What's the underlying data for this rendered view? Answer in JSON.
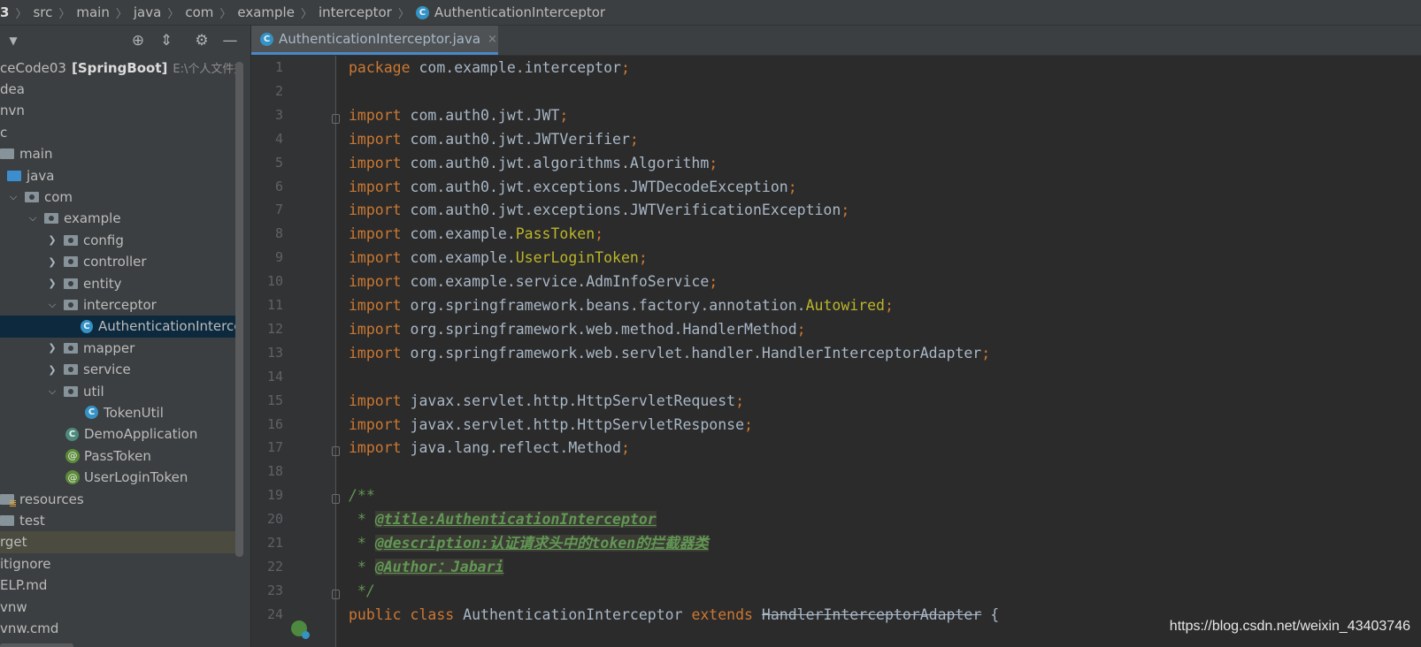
{
  "breadcrumb": [
    "3",
    "src",
    "main",
    "java",
    "com",
    "example",
    "interceptor",
    "AuthenticationInterceptor"
  ],
  "sidebar": {
    "toolbar_icons": [
      "chevron-down-icon",
      "locate-icon",
      "collapse-icon",
      "gear-icon",
      "minimize-icon"
    ],
    "project_name": "ceCode03",
    "project_module": "[SpringBoot]",
    "project_path": "E:\\个人文件夹\\",
    "tree": [
      {
        "label": "dea",
        "indent": 0,
        "icon": "none"
      },
      {
        "label": "nvn",
        "indent": 0,
        "icon": "none"
      },
      {
        "label": "c",
        "indent": 0,
        "icon": "none"
      },
      {
        "label": "main",
        "indent": 0,
        "icon": "folder"
      },
      {
        "label": "java",
        "indent": 1,
        "icon": "folder-blue"
      },
      {
        "label": "com",
        "indent": 1,
        "icon": "package",
        "chev": "⌄"
      },
      {
        "label": "example",
        "indent": 2,
        "icon": "package",
        "chev": "⌄"
      },
      {
        "label": "config",
        "indent": 3,
        "icon": "package",
        "chev": "›"
      },
      {
        "label": "controller",
        "indent": 3,
        "icon": "package",
        "chev": "›"
      },
      {
        "label": "entity",
        "indent": 3,
        "icon": "package",
        "chev": "›"
      },
      {
        "label": "interceptor",
        "indent": 3,
        "icon": "package",
        "chev": "⌄"
      },
      {
        "label": "AuthenticationIntercep",
        "indent": 4,
        "icon": "class",
        "selected": true
      },
      {
        "label": "mapper",
        "indent": 3,
        "icon": "package",
        "chev": "›"
      },
      {
        "label": "service",
        "indent": 3,
        "icon": "package",
        "chev": "›"
      },
      {
        "label": "util",
        "indent": 3,
        "icon": "package",
        "chev": "⌄"
      },
      {
        "label": "TokenUtil",
        "indent": 4,
        "icon": "class"
      },
      {
        "label": "DemoApplication",
        "indent": 3,
        "icon": "spring-class"
      },
      {
        "label": "PassToken",
        "indent": 3,
        "icon": "annotation"
      },
      {
        "label": "UserLoginToken",
        "indent": 3,
        "icon": "annotation"
      },
      {
        "label": "resources",
        "indent": 0,
        "icon": "folder-res"
      },
      {
        "label": "test",
        "indent": 0,
        "icon": "folder"
      },
      {
        "label": "rget",
        "indent": 0,
        "icon": "none",
        "hover": true
      },
      {
        "label": "itignore",
        "indent": 0,
        "icon": "none"
      },
      {
        "label": "ELP.md",
        "indent": 0,
        "icon": "none"
      },
      {
        "label": "vnw",
        "indent": 0,
        "icon": "none"
      },
      {
        "label": "vnw.cmd",
        "indent": 0,
        "icon": "none"
      }
    ]
  },
  "editor": {
    "tab_label": "AuthenticationInterceptor.java",
    "tab_close": "×",
    "line_numbers": [
      "1",
      "2",
      "3",
      "4",
      "5",
      "6",
      "7",
      "8",
      "9",
      "10",
      "11",
      "12",
      "13",
      "14",
      "15",
      "16",
      "17",
      "18",
      "19",
      "20",
      "21",
      "22",
      "23",
      "24"
    ],
    "lines": [
      [
        [
          "kw",
          "package"
        ],
        [
          "t",
          " com.example.interceptor"
        ],
        [
          "sm",
          ";"
        ]
      ],
      [],
      [
        [
          "kw",
          "import"
        ],
        [
          "t",
          " com.auth0.jwt.JWT"
        ],
        [
          "sm",
          ";"
        ]
      ],
      [
        [
          "kw",
          "import"
        ],
        [
          "t",
          " com.auth0.jwt.JWTVerifier"
        ],
        [
          "sm",
          ";"
        ]
      ],
      [
        [
          "kw",
          "import"
        ],
        [
          "t",
          " com.auth0.jwt.algorithms.Algorithm"
        ],
        [
          "sm",
          ";"
        ]
      ],
      [
        [
          "kw",
          "import"
        ],
        [
          "t",
          " com.auth0.jwt.exceptions.JWTDecodeException"
        ],
        [
          "sm",
          ";"
        ]
      ],
      [
        [
          "kw",
          "import"
        ],
        [
          "t",
          " com.auth0.jwt.exceptions.JWTVerificationException"
        ],
        [
          "sm",
          ";"
        ]
      ],
      [
        [
          "kw",
          "import"
        ],
        [
          "t",
          " com.example."
        ],
        [
          "an",
          "PassToken"
        ],
        [
          "sm",
          ";"
        ]
      ],
      [
        [
          "kw",
          "import"
        ],
        [
          "t",
          " com.example."
        ],
        [
          "an",
          "UserLoginToken"
        ],
        [
          "sm",
          ";"
        ]
      ],
      [
        [
          "kw",
          "import"
        ],
        [
          "t",
          " com.example.service.AdmInfoService"
        ],
        [
          "sm",
          ";"
        ]
      ],
      [
        [
          "kw",
          "import"
        ],
        [
          "t",
          " org.springframework.beans.factory.annotation."
        ],
        [
          "an",
          "Autowired"
        ],
        [
          "sm",
          ";"
        ]
      ],
      [
        [
          "kw",
          "import"
        ],
        [
          "t",
          " org.springframework.web.method.HandlerMethod"
        ],
        [
          "sm",
          ";"
        ]
      ],
      [
        [
          "kw",
          "import"
        ],
        [
          "t",
          " org.springframework.web.servlet.handler.HandlerInterceptorAdapter"
        ],
        [
          "sm",
          ";"
        ]
      ],
      [],
      [
        [
          "kw",
          "import"
        ],
        [
          "t",
          " javax.servlet.http.HttpServletRequest"
        ],
        [
          "sm",
          ";"
        ]
      ],
      [
        [
          "kw",
          "import"
        ],
        [
          "t",
          " javax.servlet.http.HttpServletResponse"
        ],
        [
          "sm",
          ";"
        ]
      ],
      [
        [
          "kw",
          "import"
        ],
        [
          "t",
          " java.lang.reflect.Method"
        ],
        [
          "sm",
          ";"
        ]
      ],
      [],
      [
        [
          "cm",
          "/**"
        ]
      ],
      [
        [
          "cm",
          " * "
        ],
        [
          "tag",
          "@title:AuthenticationInterceptor"
        ]
      ],
      [
        [
          "cm",
          " * "
        ],
        [
          "tag",
          "@description:认证请求头中的token的拦截器类"
        ]
      ],
      [
        [
          "cm",
          " * "
        ],
        [
          "tag",
          "@Author：Jabari"
        ]
      ],
      [
        [
          "cm",
          " */"
        ]
      ],
      [
        [
          "kw",
          "public class"
        ],
        [
          "t",
          " AuthenticationInterceptor "
        ],
        [
          "kw",
          "extends"
        ],
        [
          "t",
          " "
        ],
        [
          "st",
          "HandlerInterceptorAdapter"
        ],
        [
          "t",
          " {"
        ]
      ]
    ]
  },
  "watermark": "https://blog.csdn.net/weixin_43403746"
}
